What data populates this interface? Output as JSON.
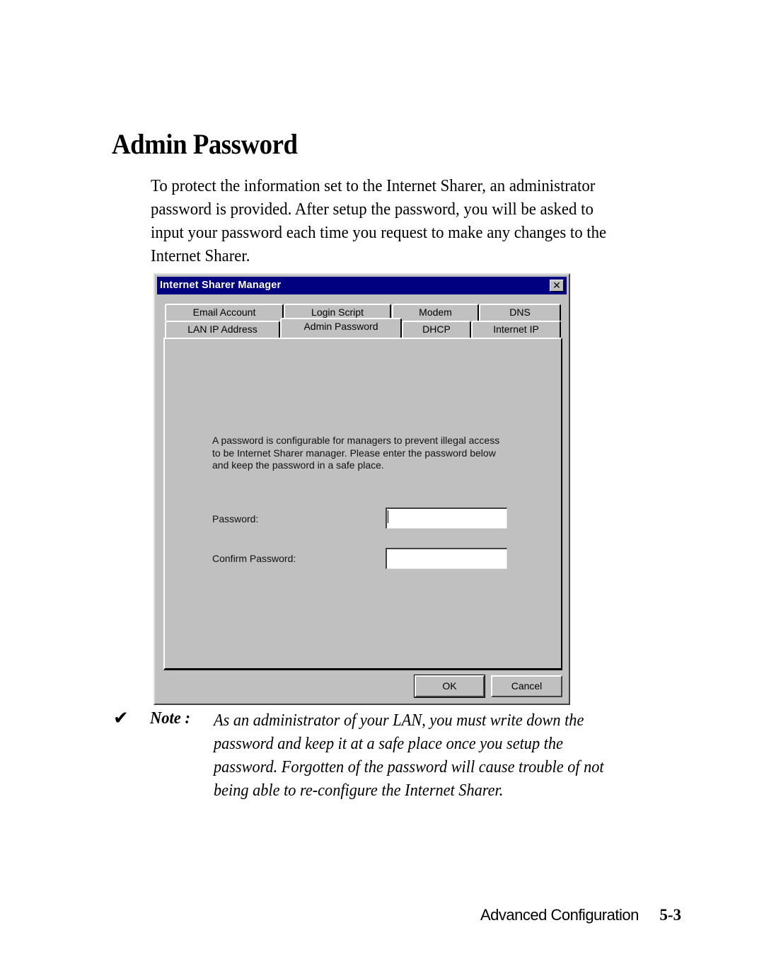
{
  "page": {
    "title": "Admin Password",
    "intro_lines": [
      "To protect the information set to the Internet Sharer, an administrator",
      "password is provided. After setup the password, you will be asked to",
      "input your password each time you request to make any changes to the",
      "Internet Sharer."
    ]
  },
  "dialog": {
    "title": "Internet Sharer Manager",
    "close_icon": "close-icon",
    "tabs_top_row": [
      "Email Account",
      "Login Script",
      "Modem",
      "DNS"
    ],
    "tabs_bottom_row": [
      "LAN IP Address",
      "Admin Password",
      "DHCP",
      "Internet IP"
    ],
    "active_tab": "Admin Password",
    "description_lines": [
      "A password is configurable for managers to prevent illegal access",
      "to be Internet Sharer manager. Please enter the password below",
      "and keep the password in a safe place."
    ],
    "fields": {
      "password_label": "Password:",
      "password_value": "",
      "confirm_label": "Confirm Password:",
      "confirm_value": ""
    },
    "buttons": {
      "ok": "OK",
      "cancel": "Cancel"
    }
  },
  "note": {
    "icon": "checkmark-icon",
    "check_glyph": "✔",
    "label": "Note :",
    "lines": [
      "As an administrator of your LAN, you must write down the",
      "password and keep it at a safe place once you setup the",
      "password. Forgotten of the password will cause trouble of not",
      "being able to re-configure the Internet Sharer."
    ]
  },
  "footer": {
    "section": "Advanced Configuration",
    "page_number": "5-3"
  }
}
